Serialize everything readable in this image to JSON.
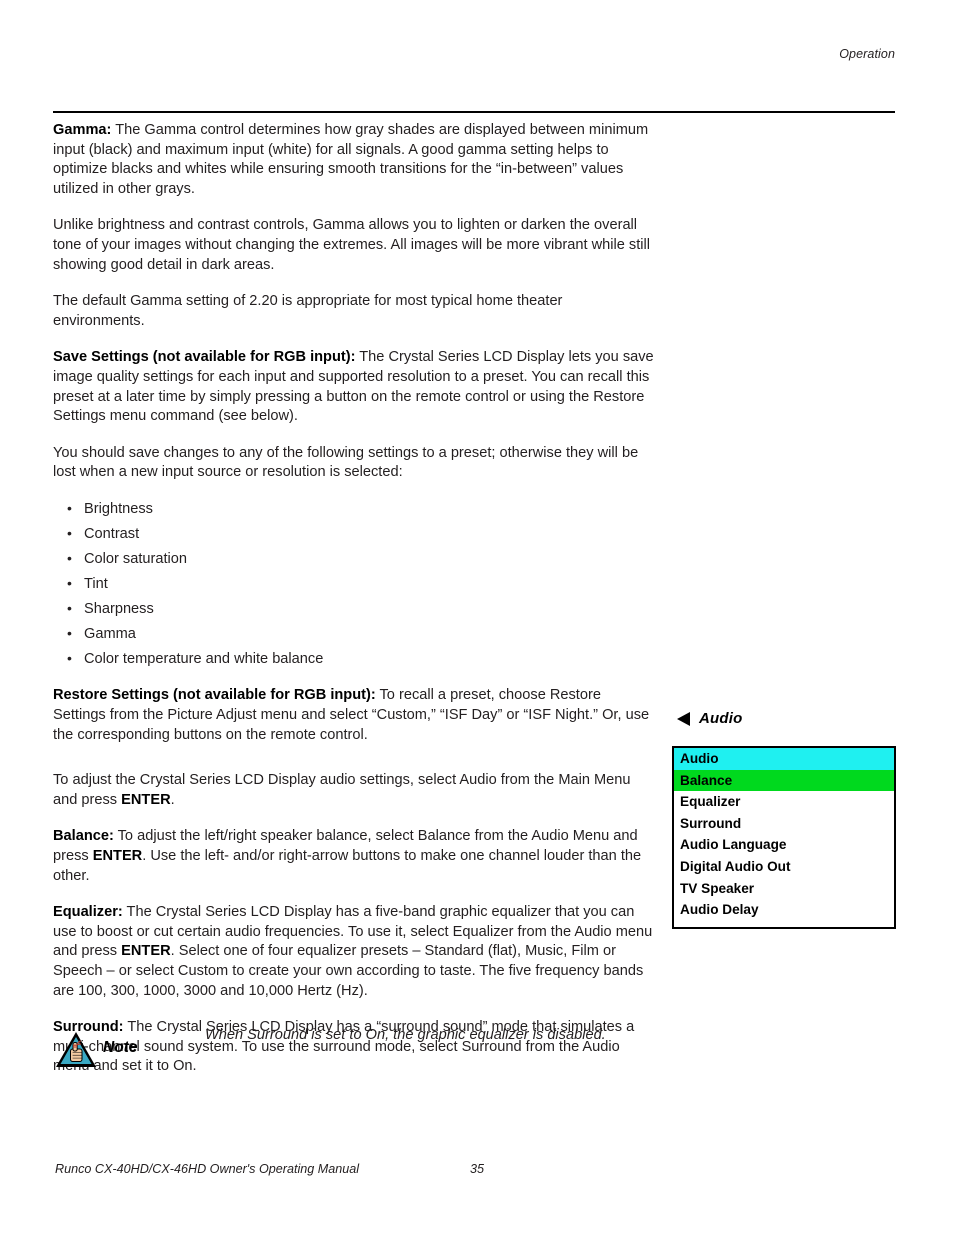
{
  "header": {
    "running_head": "Operation"
  },
  "body": {
    "paragraphs": [
      {
        "id": "gamma",
        "lead": "Gamma:",
        "text": " The Gamma control determines how gray shades are displayed between minimum input (black) and maximum input (white) for all signals. A good gamma setting helps to optimize blacks and whites while ensuring smooth transitions for the “in-between” values utilized in other grays."
      },
      {
        "id": "gamma-unlike",
        "lead": "",
        "text": "Unlike brightness and contrast controls, Gamma allows you to lighten or darken the overall tone of your images without changing the extremes. All images will be more vibrant while still showing good detail in dark areas."
      },
      {
        "id": "gamma-default",
        "lead": "",
        "text": "The default Gamma setting of 2.20 is appropriate for most typical home theater environments."
      },
      {
        "id": "save-settings",
        "lead": "Save Settings (not available for RGB input):",
        "text": " The Crystal Series LCD Display lets you save image quality settings for each input and supported resolution to a preset. You can recall this preset at a later time by simply pressing a button on the remote control or using the Restore Settings menu command (see below)."
      },
      {
        "id": "save-intro",
        "lead": "",
        "text": "You should save changes to any of the following settings to a preset; otherwise they will be lost when a new input source or resolution is selected:"
      }
    ],
    "bullets": [
      "Brightness",
      "Contrast",
      "Color saturation",
      "Tint",
      "Sharpness",
      "Gamma",
      "Color temperature and white balance"
    ],
    "paragraphs2": [
      {
        "id": "restore-settings",
        "lead": "Restore Settings (not available for RGB input):",
        "text": " To recall a preset, choose Restore Settings from the Picture Adjust menu and select “Custom,” “ISF Day” or “ISF Night.” Or, use the corresponding buttons on the remote control."
      }
    ],
    "audio_intro": {
      "part1": "To adjust the Crystal Series LCD Display audio settings, select Audio from the Main Menu and press ",
      "emphasis": "ENTER",
      "part2": "."
    },
    "balance": {
      "lead": "Balance:",
      "part1": " To adjust the left/right speaker balance, select Balance from the Audio Menu and press ",
      "emphasis": "ENTER",
      "part2": ". Use the left- and/or right-arrow buttons to make one channel louder than the other."
    },
    "equalizer": {
      "lead": "Equalizer:",
      "part1": " The Crystal Series LCD Display has a five-band graphic equalizer that you can use to boost or cut certain audio frequencies. To use it, select Equalizer from the Audio menu and press ",
      "emphasis": "ENTER",
      "part2": ". Select one of four equalizer presets – Standard (flat), Music, Film or Speech – or select Custom to create your own according to taste. The five frequency bands are 100, 300, 1000, 3000 and 10,000 Hertz (Hz)."
    },
    "surround": {
      "lead": "Surround:",
      "text": " The Crystal Series LCD Display has a “surround sound” mode that simulates a multi-channel sound system. To use the surround mode, select Surround from the Audio menu and set it to On."
    }
  },
  "osd": {
    "title": "Audio",
    "arrow_icon": "arrow-left-icon",
    "items": [
      {
        "label": "Audio",
        "state": "header-highlight"
      },
      {
        "label": "Balance",
        "state": "selected"
      },
      {
        "label": "Equalizer",
        "state": "normal"
      },
      {
        "label": "Surround",
        "state": "normal"
      },
      {
        "label": "Audio Language",
        "state": "normal"
      },
      {
        "label": "Digital Audio Out",
        "state": "normal"
      },
      {
        "label": "TV Speaker",
        "state": "normal"
      },
      {
        "label": "Audio Delay",
        "state": "normal"
      }
    ],
    "colors": {
      "header_highlight": "#1ff0f0",
      "selected": "#00d91e",
      "border": "#000000",
      "background": "#ffffff"
    }
  },
  "note": {
    "icon": "note-hand-reminder-icon",
    "label": "Note",
    "text": "When Surround is set to On, the graphic equalizer is disabled."
  },
  "footer": {
    "manual_title": "Runco CX-40HD/CX-46HD Owner's Operating Manual",
    "page_number": "35"
  }
}
